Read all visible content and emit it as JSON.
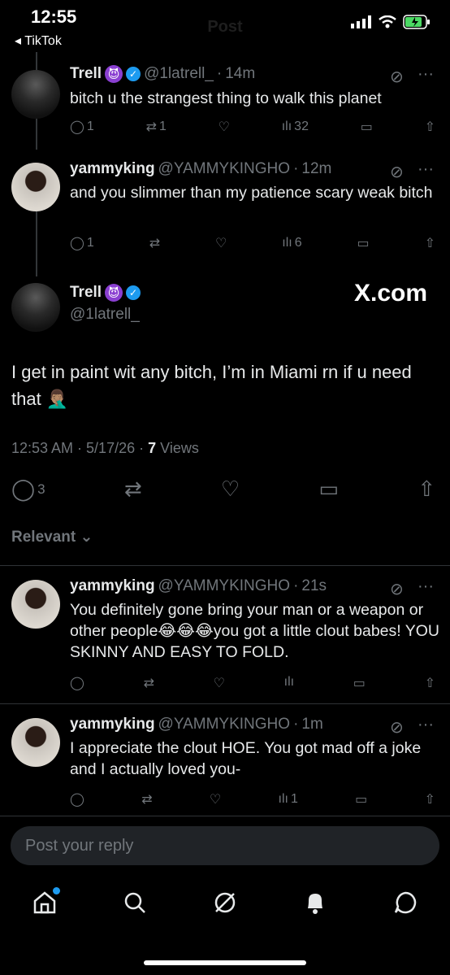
{
  "status": {
    "time": "12:55",
    "back_app": "TikTok",
    "header_title": "Post"
  },
  "tweets": [
    {
      "name": "Trell",
      "handle": "@1latrell_",
      "time": "14m",
      "text": "bitch u the strangest thing to walk this planet",
      "replies": "1",
      "reposts": "1",
      "likes": "",
      "views": "32"
    },
    {
      "name": "yammyking",
      "handle": "@YAMMYKINGHO",
      "time": "12m",
      "text": "and you slimmer than my patience scary weak bitch",
      "replies": "1",
      "reposts": "",
      "likes": "",
      "views": "6"
    }
  ],
  "main": {
    "name": "Trell",
    "handle": "@1latrell_",
    "watermark": "X.com",
    "text": "I get in paint wit any bitch, I’m in Miami rn if u need that 🤦🏽‍♂️",
    "timestamp": "12:53 AM · 5/17/26 ·",
    "views_count": "7",
    "views_label": "Views",
    "replies": "3"
  },
  "sort_label": "Relevant",
  "replies": [
    {
      "name": "yammyking",
      "handle": "@YAMMYKINGHO",
      "time": "21s",
      "text": "You definitely gone bring your man or a weapon or other people😂😂😂you got a little clout babes! YOU SKINNY AND EASY TO FOLD.",
      "views": ""
    },
    {
      "name": "yammyking",
      "handle": "@YAMMYKINGHO",
      "time": "1m",
      "text": "I appreciate the clout HOE. You got mad off a joke and I actually loved you-",
      "views": "1"
    }
  ],
  "compose": {
    "placeholder": "Post your reply"
  },
  "nav": [
    "home-icon",
    "search-icon",
    "grok-icon",
    "notifications-icon",
    "messages-icon"
  ]
}
